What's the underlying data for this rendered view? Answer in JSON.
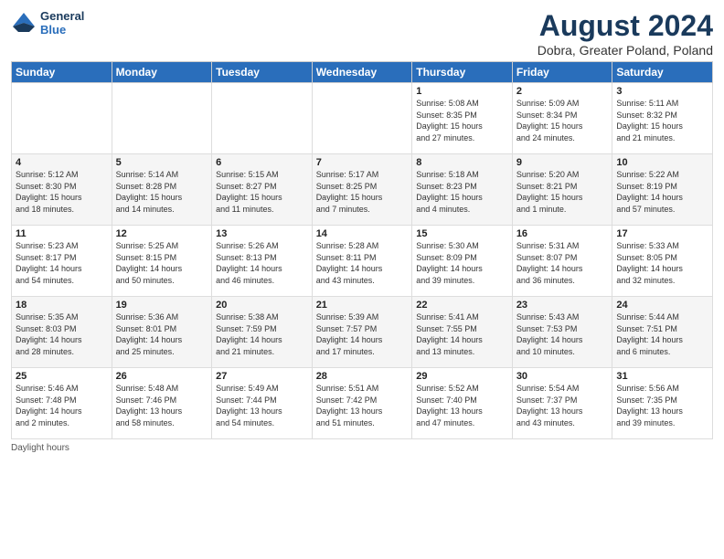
{
  "header": {
    "logo_line1": "General",
    "logo_line2": "Blue",
    "month_year": "August 2024",
    "location": "Dobra, Greater Poland, Poland"
  },
  "days_of_week": [
    "Sunday",
    "Monday",
    "Tuesday",
    "Wednesday",
    "Thursday",
    "Friday",
    "Saturday"
  ],
  "weeks": [
    [
      {
        "day": "",
        "info": ""
      },
      {
        "day": "",
        "info": ""
      },
      {
        "day": "",
        "info": ""
      },
      {
        "day": "",
        "info": ""
      },
      {
        "day": "1",
        "info": "Sunrise: 5:08 AM\nSunset: 8:35 PM\nDaylight: 15 hours\nand 27 minutes."
      },
      {
        "day": "2",
        "info": "Sunrise: 5:09 AM\nSunset: 8:34 PM\nDaylight: 15 hours\nand 24 minutes."
      },
      {
        "day": "3",
        "info": "Sunrise: 5:11 AM\nSunset: 8:32 PM\nDaylight: 15 hours\nand 21 minutes."
      }
    ],
    [
      {
        "day": "4",
        "info": "Sunrise: 5:12 AM\nSunset: 8:30 PM\nDaylight: 15 hours\nand 18 minutes."
      },
      {
        "day": "5",
        "info": "Sunrise: 5:14 AM\nSunset: 8:28 PM\nDaylight: 15 hours\nand 14 minutes."
      },
      {
        "day": "6",
        "info": "Sunrise: 5:15 AM\nSunset: 8:27 PM\nDaylight: 15 hours\nand 11 minutes."
      },
      {
        "day": "7",
        "info": "Sunrise: 5:17 AM\nSunset: 8:25 PM\nDaylight: 15 hours\nand 7 minutes."
      },
      {
        "day": "8",
        "info": "Sunrise: 5:18 AM\nSunset: 8:23 PM\nDaylight: 15 hours\nand 4 minutes."
      },
      {
        "day": "9",
        "info": "Sunrise: 5:20 AM\nSunset: 8:21 PM\nDaylight: 15 hours\nand 1 minute."
      },
      {
        "day": "10",
        "info": "Sunrise: 5:22 AM\nSunset: 8:19 PM\nDaylight: 14 hours\nand 57 minutes."
      }
    ],
    [
      {
        "day": "11",
        "info": "Sunrise: 5:23 AM\nSunset: 8:17 PM\nDaylight: 14 hours\nand 54 minutes."
      },
      {
        "day": "12",
        "info": "Sunrise: 5:25 AM\nSunset: 8:15 PM\nDaylight: 14 hours\nand 50 minutes."
      },
      {
        "day": "13",
        "info": "Sunrise: 5:26 AM\nSunset: 8:13 PM\nDaylight: 14 hours\nand 46 minutes."
      },
      {
        "day": "14",
        "info": "Sunrise: 5:28 AM\nSunset: 8:11 PM\nDaylight: 14 hours\nand 43 minutes."
      },
      {
        "day": "15",
        "info": "Sunrise: 5:30 AM\nSunset: 8:09 PM\nDaylight: 14 hours\nand 39 minutes."
      },
      {
        "day": "16",
        "info": "Sunrise: 5:31 AM\nSunset: 8:07 PM\nDaylight: 14 hours\nand 36 minutes."
      },
      {
        "day": "17",
        "info": "Sunrise: 5:33 AM\nSunset: 8:05 PM\nDaylight: 14 hours\nand 32 minutes."
      }
    ],
    [
      {
        "day": "18",
        "info": "Sunrise: 5:35 AM\nSunset: 8:03 PM\nDaylight: 14 hours\nand 28 minutes."
      },
      {
        "day": "19",
        "info": "Sunrise: 5:36 AM\nSunset: 8:01 PM\nDaylight: 14 hours\nand 25 minutes."
      },
      {
        "day": "20",
        "info": "Sunrise: 5:38 AM\nSunset: 7:59 PM\nDaylight: 14 hours\nand 21 minutes."
      },
      {
        "day": "21",
        "info": "Sunrise: 5:39 AM\nSunset: 7:57 PM\nDaylight: 14 hours\nand 17 minutes."
      },
      {
        "day": "22",
        "info": "Sunrise: 5:41 AM\nSunset: 7:55 PM\nDaylight: 14 hours\nand 13 minutes."
      },
      {
        "day": "23",
        "info": "Sunrise: 5:43 AM\nSunset: 7:53 PM\nDaylight: 14 hours\nand 10 minutes."
      },
      {
        "day": "24",
        "info": "Sunrise: 5:44 AM\nSunset: 7:51 PM\nDaylight: 14 hours\nand 6 minutes."
      }
    ],
    [
      {
        "day": "25",
        "info": "Sunrise: 5:46 AM\nSunset: 7:48 PM\nDaylight: 14 hours\nand 2 minutes."
      },
      {
        "day": "26",
        "info": "Sunrise: 5:48 AM\nSunset: 7:46 PM\nDaylight: 13 hours\nand 58 minutes."
      },
      {
        "day": "27",
        "info": "Sunrise: 5:49 AM\nSunset: 7:44 PM\nDaylight: 13 hours\nand 54 minutes."
      },
      {
        "day": "28",
        "info": "Sunrise: 5:51 AM\nSunset: 7:42 PM\nDaylight: 13 hours\nand 51 minutes."
      },
      {
        "day": "29",
        "info": "Sunrise: 5:52 AM\nSunset: 7:40 PM\nDaylight: 13 hours\nand 47 minutes."
      },
      {
        "day": "30",
        "info": "Sunrise: 5:54 AM\nSunset: 7:37 PM\nDaylight: 13 hours\nand 43 minutes."
      },
      {
        "day": "31",
        "info": "Sunrise: 5:56 AM\nSunset: 7:35 PM\nDaylight: 13 hours\nand 39 minutes."
      }
    ]
  ],
  "footer": {
    "text": "Daylight hours"
  }
}
